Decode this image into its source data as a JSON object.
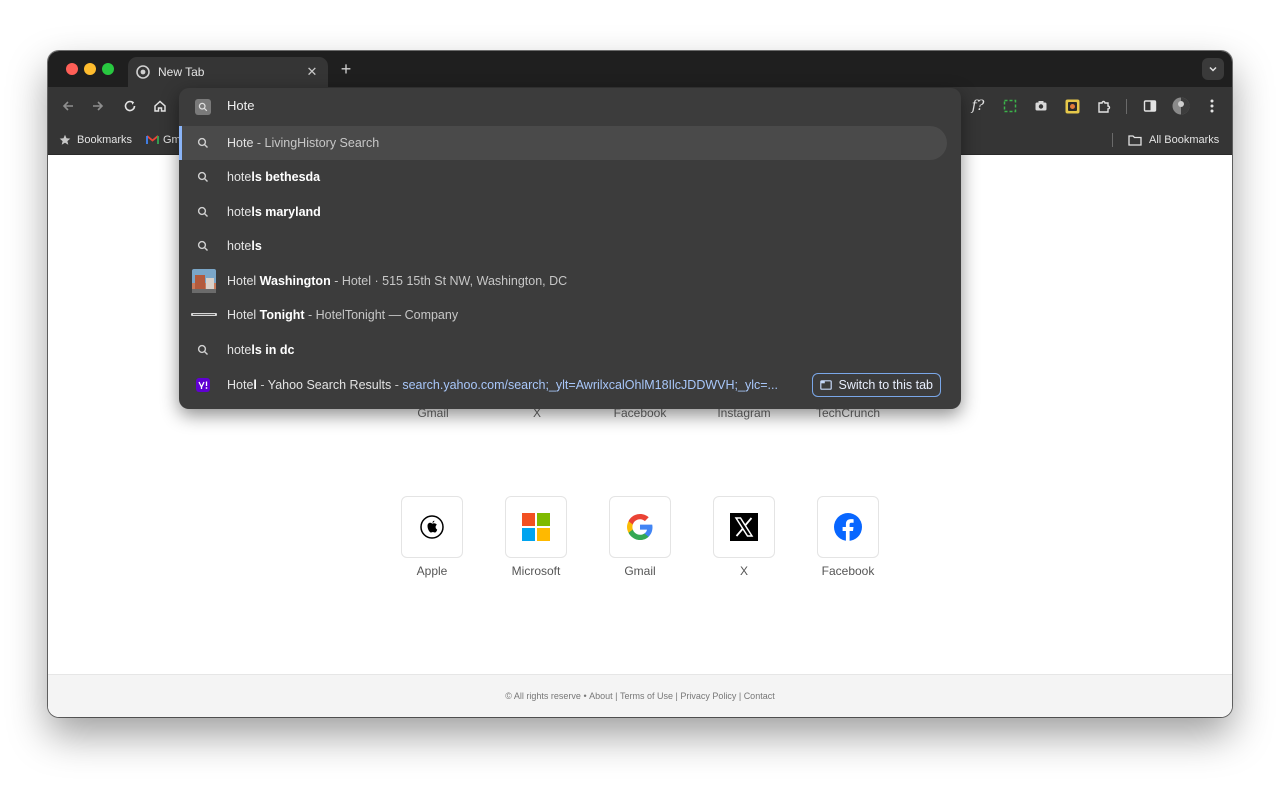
{
  "window": {
    "tab": {
      "title": "New Tab"
    }
  },
  "toolbar": {
    "extensions_label": "f?"
  },
  "bookmarks_bar": {
    "bookmarks_label": "Bookmarks",
    "gmail_label": "Gm",
    "all_bookmarks_label": "All Bookmarks"
  },
  "omnibox": {
    "query": "Hote",
    "suggestions": [
      {
        "prefix": "Hote",
        "bold": "",
        "sep": " - ",
        "detail": "LivingHistory Search"
      },
      {
        "prefix": "hote",
        "bold": "ls bethesda",
        "sep": "",
        "detail": ""
      },
      {
        "prefix": "hote",
        "bold": "ls maryland",
        "sep": "",
        "detail": ""
      },
      {
        "prefix": "hote",
        "bold": "ls",
        "sep": "",
        "detail": ""
      },
      {
        "prefix": "Hotel ",
        "bold": "Washington",
        "sep": " - ",
        "detail": "Hotel · 515 15th St NW, Washington, DC"
      },
      {
        "prefix": "Hotel ",
        "bold": "Tonight",
        "sep": " - ",
        "detail": "HotelTonight — Company"
      },
      {
        "prefix": "hote",
        "bold": "ls in dc",
        "sep": "",
        "detail": ""
      },
      {
        "prefix": "Hote",
        "bold": "l",
        "sep": " - ",
        "detail": "Yahoo Search Results",
        "url_sep": " - ",
        "url": "search.yahoo.com/search;_ylt=AwrilxcalOhlM18IlcJDDWVH;_ylc=...",
        "action": "Switch to this tab"
      }
    ]
  },
  "shortcuts_row1": [
    "Gmail",
    "X",
    "Facebook",
    "Instagram",
    "TechCrunch"
  ],
  "shortcuts_row2": [
    "Apple",
    "Microsoft",
    "Gmail",
    "X",
    "Facebook"
  ],
  "footer": {
    "copyright": "© All rights reserve",
    "bullet": " • ",
    "about": "About",
    "sep1": " | ",
    "terms": "Terms of Use",
    "sep2": " | ",
    "privacy": "Privacy Policy",
    "sep3": " | ",
    "contact": "Contact"
  },
  "colors": {
    "accent": "#8ab4f8",
    "url": "#a8c7fa",
    "dropdown_bg": "#3c3c3c",
    "toolbar_bg": "#353535"
  }
}
